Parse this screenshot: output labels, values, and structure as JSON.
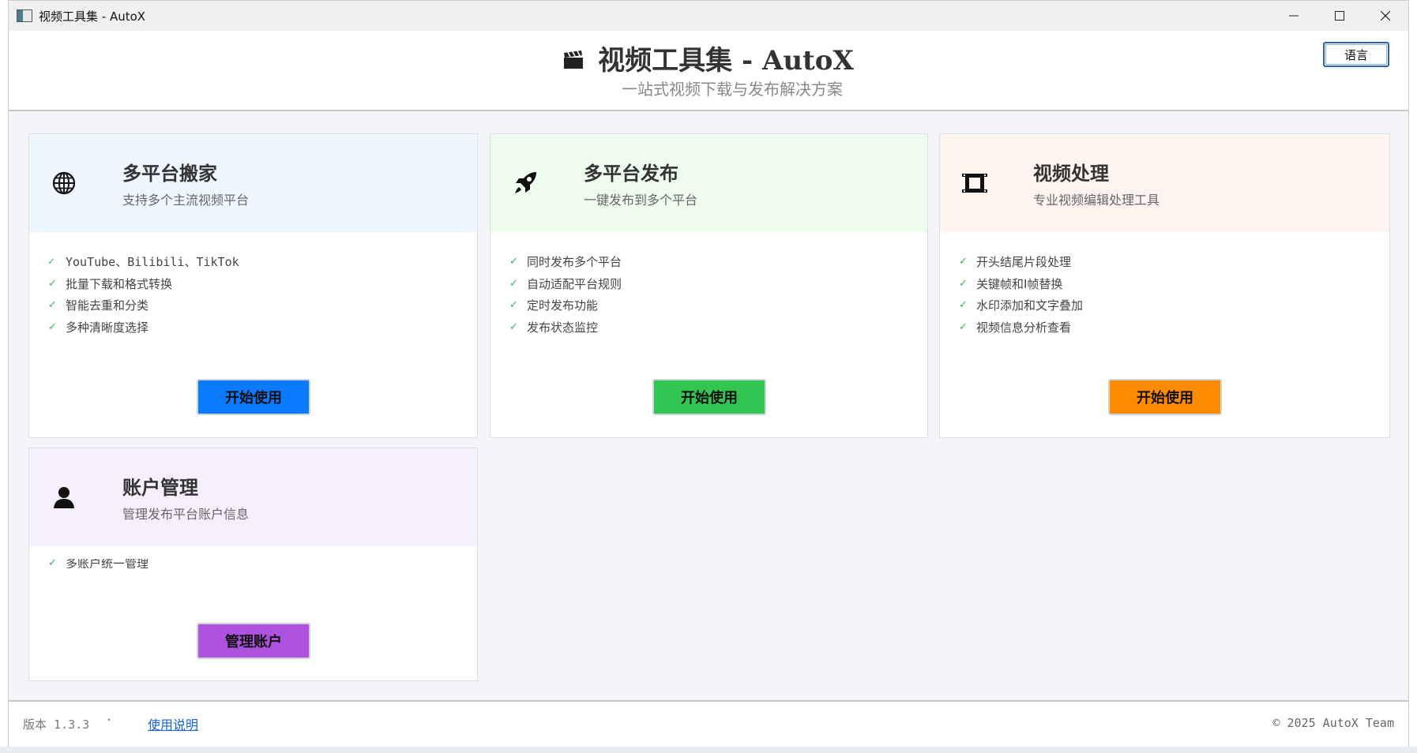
{
  "window": {
    "title": "视频工具集 - AutoX",
    "controls": {
      "minimize": "—",
      "maximize": "☐",
      "close": "✕"
    }
  },
  "header": {
    "icon": "clapperboard-icon",
    "title": "视频工具集 - AutoX",
    "subtitle": "一站式视频下载与发布解决方案",
    "lang_button": "语言"
  },
  "cards": [
    {
      "icon": "globe-icon",
      "title": "多平台搬家",
      "description": "支持多个主流视频平台",
      "features": [
        "YouTube、Bilibili、TikTok",
        "批量下载和格式转换",
        "智能去重和分类",
        "多种清晰度选择"
      ],
      "button": "开始使用",
      "header_color": "#eef6ff",
      "button_color": "#0a7aff"
    },
    {
      "icon": "rocket-icon",
      "title": "多平台发布",
      "description": "一键发布到多个平台",
      "features": [
        "同时发布多个平台",
        "自动适配平台规则",
        "定时发布功能",
        "发布状态监控"
      ],
      "button": "开始使用",
      "header_color": "#eefcee",
      "button_color": "#33c552"
    },
    {
      "icon": "film-icon",
      "title": "视频处理",
      "description": "专业视频编辑处理工具",
      "features": [
        "开头结尾片段处理",
        "关键帧和I帧替换",
        "水印添加和文字叠加",
        "视频信息分析查看"
      ],
      "button": "开始使用",
      "header_color": "#fdf3ef",
      "button_color": "#ff8c00"
    },
    {
      "icon": "user-icon",
      "title": "账户管理",
      "description": "管理发布平台账户信息",
      "features": [
        "多账户统一管理"
      ],
      "button": "管理账户",
      "header_color": "#f6effc",
      "button_color": "#ad52de"
    }
  ],
  "footer": {
    "version": "版本 1.3.3",
    "separator": "•",
    "help_link": "使用说明",
    "copyright": "© 2025 AutoX Team"
  },
  "check_mark": "✓"
}
